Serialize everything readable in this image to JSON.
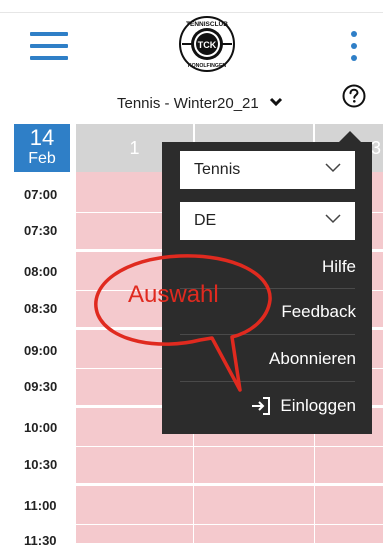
{
  "header": {
    "menu_icon": "hamburger-icon",
    "logo_top_text": "TENNISCLUB",
    "logo_center_text": "TCK",
    "logo_bottom_text": "KONOLFINGEN",
    "more_icon": "kebab-icon",
    "accent_color": "#2f7fc7"
  },
  "group_selector": {
    "label": "Tennis - Winter20_21",
    "icon": "chevron-down-icon"
  },
  "help_icon": "question-circle-icon",
  "calendar": {
    "day": "14",
    "month": "Feb",
    "columns": [
      "1",
      "",
      "3"
    ],
    "times": [
      "07:00",
      "07:30",
      "08:00",
      "08:30",
      "09:00",
      "09:30",
      "10:00",
      "10:30",
      "11:00",
      "11:30"
    ],
    "slot_color": "#f4c9cd"
  },
  "menu": {
    "sport_select": "Tennis",
    "language_select": "DE",
    "items": [
      "Hilfe",
      "Feedback",
      "Abonnieren",
      "Einloggen"
    ],
    "login_icon": "login-icon",
    "background_color": "#2c2c2c"
  },
  "annotation": {
    "text": "Auswahl",
    "color": "#e02a1f"
  }
}
